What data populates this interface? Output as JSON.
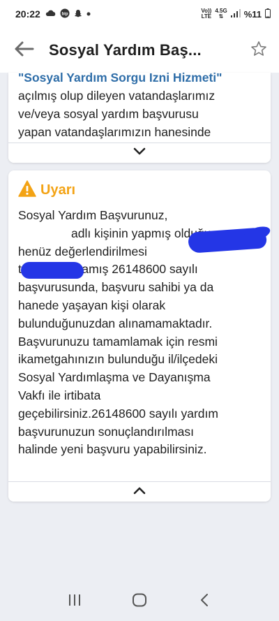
{
  "status_bar": {
    "time": "20:22",
    "notification_icons": [
      "cloud-icon",
      "bip-icon",
      "snapchat-icon",
      "dot-icon"
    ],
    "network_top": "Vo))",
    "network_bottom": "LTE",
    "network_type_top": "4.5G",
    "network_type_bottom": "⇅",
    "battery": "%11"
  },
  "app_bar": {
    "title": "Sosyal Yardım Baş..."
  },
  "card_info": {
    "link_text": "\"Sosyal Yardım Sorgu İzni Hizmeti\"",
    "lines": [
      "açılmış olup dileyen vatandaşlarımız",
      "ve/veya sosyal yardım başvurusu",
      "yapan vatandaşlarımızın hanesinde"
    ],
    "toggle_icon": "chevron-down-icon"
  },
  "card_warning": {
    "title": "Uyarı",
    "title_icon": "warning-icon",
    "lines": [
      "Sosyal Yardım Başvurunuz, ",
      "adlı kişinin yapmış olduğu ve",
      "henüz değerlendirilmesi",
      "tamamlanmamış 26148600 sayılı",
      "başvurusunda, başvuru sahibi ya da",
      "hanede yaşayan kişi olarak",
      "bulunduğunuzdan alınamamaktadır.",
      "Başvurunuzu tamamlamak için resmi",
      "ikametgahınızın bulunduğu il/ilçedeki",
      "Sosyal Yardımlaşma ve Dayanışma",
      "Vakfı ile irtibata",
      "geçebilirsiniz.26148600 sayılı yardım",
      "başvurunuzun sonuçlandırılması",
      "halinde yeni başvuru yapabilirsiniz."
    ],
    "toggle_icon": "chevron-up-icon"
  },
  "colors": {
    "link": "#2e6da8",
    "warning": "#f3a315",
    "redaction": "#2436e6",
    "background": "#eceef3"
  }
}
